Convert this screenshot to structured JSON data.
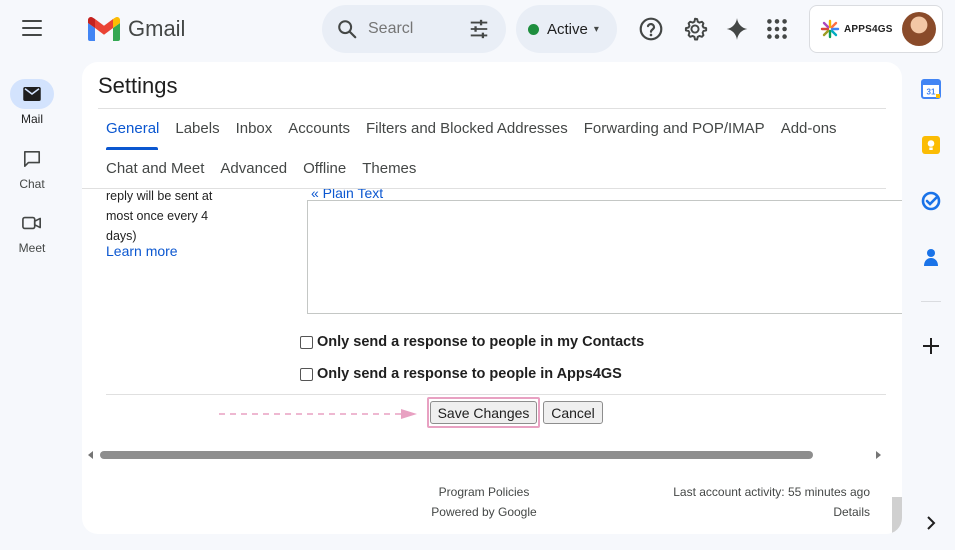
{
  "app": {
    "name": "Gmail"
  },
  "search": {
    "placeholder": "Searcl"
  },
  "status": {
    "label": "Active",
    "color": "#1e8e3e"
  },
  "account": {
    "brand": "APPS4GS"
  },
  "nav": [
    {
      "label": "Mail",
      "icon": "mail-icon"
    },
    {
      "label": "Chat",
      "icon": "chat-icon"
    },
    {
      "label": "Meet",
      "icon": "video-icon"
    }
  ],
  "settings": {
    "title": "Settings",
    "tabs_row1": [
      "General",
      "Labels",
      "Inbox",
      "Accounts",
      "Filters and Blocked Addresses",
      "Forwarding and POP/IMAP",
      "Add-ons"
    ],
    "tabs_row2": [
      "Chat and Meet",
      "Advanced",
      "Offline",
      "Themes"
    ],
    "selected_tab": "General"
  },
  "vacation": {
    "desc_lines": [
      "reply will be sent at",
      "most once every 4",
      "days)"
    ],
    "learn_more": "Learn more",
    "plain_text_link": "« Plain Text",
    "option_contacts": "Only send a response to people in my Contacts",
    "option_domain": "Only send a response to people in Apps4GS"
  },
  "buttons": {
    "save": "Save Changes",
    "cancel": "Cancel"
  },
  "footer": {
    "program_policies": "Program Policies",
    "powered_by": "Powered by Google",
    "last_activity": "Last account activity: 55 minutes ago",
    "details": "Details"
  },
  "colors": {
    "accent": "#0b57d0",
    "highlight": "#e8a1c2"
  }
}
